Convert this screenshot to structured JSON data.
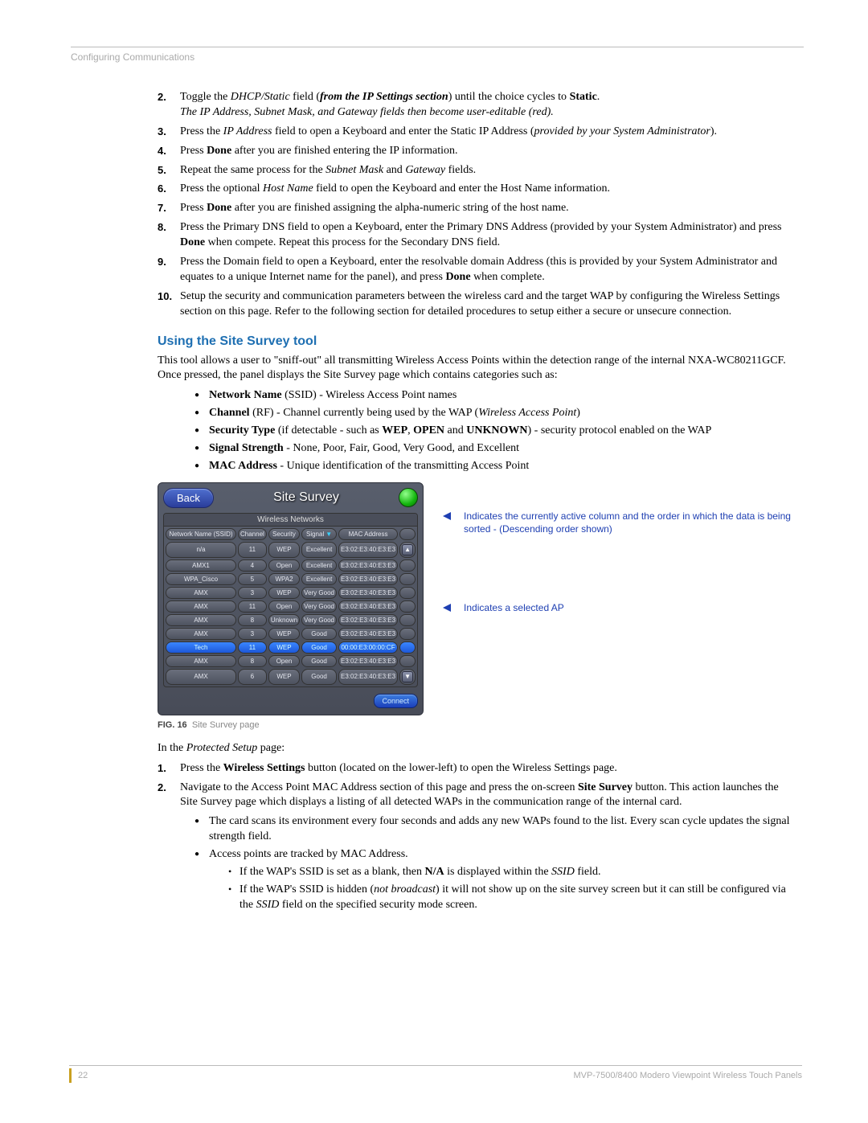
{
  "header": {
    "breadcrumb": "Configuring Communications"
  },
  "steps_a": [
    {
      "n": "2.",
      "html": "Toggle the <span class='italic'>DHCP/Static</span> field (<span class='bold italic'>from the IP Settings section</span>) until the choice cycles to <b>Static</b>.<br><span class='italic'>The IP Address, Subnet Mask, and Gateway fields then become user-editable (red).</span>"
    },
    {
      "n": "3.",
      "html": "Press the <span class='italic'>IP Address</span> field to open a Keyboard and enter the Static IP Address (<span class='italic'>provided by your System Administrator</span>)."
    },
    {
      "n": "4.",
      "html": "Press <b>Done</b> after you are finished entering the IP information."
    },
    {
      "n": "5.",
      "html": "Repeat the same process for the <span class='italic'>Subnet Mask</span> and <span class='italic'>Gateway</span> fields."
    },
    {
      "n": "6.",
      "html": "Press the optional <span class='italic'>Host Name</span> field to open the Keyboard and enter the Host Name information."
    },
    {
      "n": "7.",
      "html": "Press <b>Done</b> after you are finished assigning the alpha-numeric string of the host name."
    },
    {
      "n": "8.",
      "html": "Press the Primary DNS field to open a Keyboard, enter the Primary DNS Address (provided by your System Administrator) and press <b>Done</b> when compete. Repeat this process for the Secondary DNS field."
    },
    {
      "n": "9.",
      "html": "Press the Domain field to open a Keyboard, enter the resolvable domain Address (this is provided by your System Administrator and equates to a unique Internet name for the panel), and press <b>Done</b> when complete."
    },
    {
      "n": "10.",
      "html": "Setup the security and communication parameters between the wireless card and the target WAP by configuring the Wireless Settings section on this page. Refer to the following section for detailed procedures to setup either a secure or unsecure connection."
    }
  ],
  "section_b": {
    "title": "Using the Site Survey tool",
    "intro": "This tool allows a user to \"sniff-out\" all transmitting Wireless Access Points within the detection range of the internal NXA-WC80211GCF. Once pressed, the panel displays the Site Survey page which contains categories such as:",
    "bullets": [
      "<b>Network Name</b> (SSID) - Wireless Access Point names",
      "<b>Channel</b> (RF) - Channel currently being used by the WAP (<span class='italic'>Wireless Access Point</span>)",
      "<b>Security Type</b> (if detectable - such as <b>WEP</b>, <b>OPEN</b> and <b>UNKNOWN</b>) - security protocol enabled on the WAP",
      "<b>Signal Strength</b> - None, Poor, Fair, Good, Very Good, and Excellent",
      "<b>MAC Address</b> - Unique identification of the transmitting Access Point"
    ]
  },
  "survey": {
    "back": "Back",
    "title": "Site Survey",
    "subheader": "Wireless Networks",
    "cols": [
      "Network Name (SSID)",
      "Channel",
      "Security",
      "Signal",
      "MAC Address"
    ],
    "sort_col_index": 3,
    "rows": [
      {
        "ssid": "n/a",
        "ch": "11",
        "sec": "WEP",
        "sig": "Excellent",
        "mac": "E3:02:E3:40:E3:E3",
        "sel": false
      },
      {
        "ssid": "AMX1",
        "ch": "4",
        "sec": "Open",
        "sig": "Excellent",
        "mac": "E3:02:E3:40:E3:E3",
        "sel": false
      },
      {
        "ssid": "WPA_Cisco",
        "ch": "5",
        "sec": "WPA2",
        "sig": "Excellent",
        "mac": "E3:02:E3:40:E3:E3",
        "sel": false
      },
      {
        "ssid": "AMX",
        "ch": "3",
        "sec": "WEP",
        "sig": "Very Good",
        "mac": "E3:02:E3:40:E3:E3",
        "sel": false
      },
      {
        "ssid": "AMX",
        "ch": "11",
        "sec": "Open",
        "sig": "Very Good",
        "mac": "E3:02:E3:40:E3:E3",
        "sel": false
      },
      {
        "ssid": "AMX",
        "ch": "8",
        "sec": "Unknown",
        "sig": "Very Good",
        "mac": "E3:02:E3:40:E3:E3",
        "sel": false
      },
      {
        "ssid": "AMX",
        "ch": "3",
        "sec": "WEP",
        "sig": "Good",
        "mac": "E3:02:E3:40:E3:E3",
        "sel": false
      },
      {
        "ssid": "Tech",
        "ch": "11",
        "sec": "WEP",
        "sig": "Good",
        "mac": "00:00:E3:00:00:CF",
        "sel": true
      },
      {
        "ssid": "AMX",
        "ch": "8",
        "sec": "Open",
        "sig": "Good",
        "mac": "E3:02:E3:40:E3:E3",
        "sel": false
      },
      {
        "ssid": "AMX",
        "ch": "6",
        "sec": "WEP",
        "sig": "Good",
        "mac": "E3:02:E3:40:E3:E3",
        "sel": false
      }
    ],
    "connect": "Connect"
  },
  "callouts": {
    "c1": "Indicates the currently active column and the order in which the data is being sorted - (Descending order shown)",
    "c2": "Indicates a selected AP"
  },
  "fig_caption": {
    "label": "FIG. 16",
    "text": "Site Survey page"
  },
  "after_fig": "In the <span class='italic'>Protected Setup</span> page:",
  "steps_c": [
    {
      "n": "1.",
      "html": "Press the <b>Wireless Settings</b> button (located on the lower-left) to open the Wireless Settings page."
    },
    {
      "n": "2.",
      "html": "Navigate to the Access Point MAC Address section of this page and press the on-screen <b>Site Survey</b> button. This action launches the Site Survey page which displays a listing of all detected WAPs in the communication range of the internal card."
    }
  ],
  "bullets_c": [
    "The card scans its environment every four seconds and adds any new WAPs found to the list. Every scan cycle updates the signal strength field.",
    "Access points are tracked by MAC Address."
  ],
  "sub_bullets_c": [
    "If the WAP's SSID is set as a blank, then <b>N/A</b> is displayed within the <span class='italic'>SSID</span> field.",
    "If the WAP's SSID is hidden (<span class='italic'>not broadcast</span>) it will not show up on the site survey screen but it can still be configured via the <span class='italic'>SSID</span> field on the specified security mode screen."
  ],
  "footer": {
    "page": "22",
    "doc": "MVP-7500/8400 Modero Viewpoint Wireless Touch Panels"
  }
}
